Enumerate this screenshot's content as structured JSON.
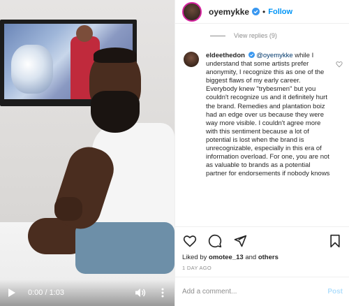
{
  "video": {
    "time_display": "0:00 / 1:03"
  },
  "header": {
    "username": "oyemykke",
    "separator": "•",
    "follow_label": "Follow"
  },
  "replies": {
    "label": "View replies (9)"
  },
  "comment": {
    "username": "eldeethedon",
    "mention": "@oyemykke",
    "text": "while I understand that some artists prefer anonymity, I recognize this as one of the biggest flaws of my early career. Everybody knew \"trybesmen\" but you couldn't recognize us and it definitely hurt the brand. Remedies and plantation boiz had an edge over us because they were way more visible. I couldn't agree more with this sentiment because a lot of potential is lost when the brand is unrecognizable, especially in this era of information overload. For one, you are not as valuable to brands as a potential partner for endorsements if nobody knows"
  },
  "likes": {
    "prefix": "Liked by",
    "user": "omotee_13",
    "conjunction": "and",
    "others": "others"
  },
  "timestamp": "1 DAY AGO",
  "add_comment": {
    "placeholder": "Add a comment...",
    "post_label": "Post"
  },
  "colors": {
    "accent": "#0095f6",
    "post_disabled": "#b2dffc",
    "muted": "#8e8e8e"
  }
}
